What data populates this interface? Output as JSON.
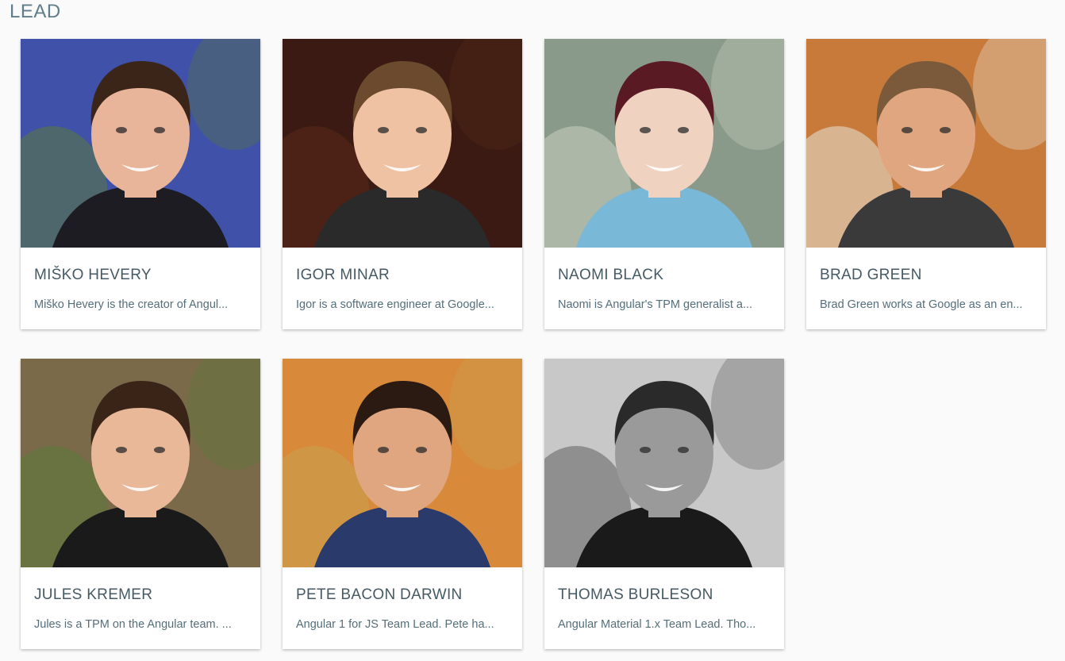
{
  "section": {
    "title": "LEAD"
  },
  "members": [
    {
      "name": "MIŠKO HEVERY",
      "desc": "Miško Hevery is the creator of Angul...",
      "photo": {
        "bg": "#3f51a8",
        "skin": "#e8b49a",
        "hair": "#3b2418",
        "shirt": "#1c1c22",
        "accent": "#5a7a3a"
      }
    },
    {
      "name": "IGOR MINAR",
      "desc": "Igor is a software engineer at Google...",
      "photo": {
        "bg": "#3a1a12",
        "skin": "#f0c2a4",
        "hair": "#6b4a2e",
        "shirt": "#2a2a2a",
        "accent": "#5a2a18"
      }
    },
    {
      "name": "NAOMI BLACK",
      "desc": "Naomi is Angular's TPM generalist a...",
      "photo": {
        "bg": "#8a9a8a",
        "skin": "#f0d2c0",
        "hair": "#5a1a24",
        "shirt": "#7ab8d8",
        "accent": "#c8d0c0"
      }
    },
    {
      "name": "BRAD GREEN",
      "desc": "Brad Green works at Google as an en...",
      "photo": {
        "bg": "#c87a3a",
        "skin": "#e0a680",
        "hair": "#7a5a3a",
        "shirt": "#3a3a3a",
        "accent": "#e8e4d8"
      }
    },
    {
      "name": "JULES KREMER",
      "desc": "Jules is a TPM on the Angular team. ...",
      "photo": {
        "bg": "#7a6a4a",
        "skin": "#e8b898",
        "hair": "#3a2418",
        "shirt": "#1a1a1a",
        "accent": "#5a7a3a"
      }
    },
    {
      "name": "PETE BACON DARWIN",
      "desc": "Angular 1 for JS Team Lead. Pete ha...",
      "photo": {
        "bg": "#d88a3a",
        "skin": "#e0a680",
        "hair": "#2a1a12",
        "shirt": "#2a3a6a",
        "accent": "#c8a050"
      }
    },
    {
      "name": "THOMAS BURLESON",
      "desc": "Angular Material 1.x Team Lead. Tho...",
      "photo": {
        "bg": "#c8c8c8",
        "skin": "#9a9a9a",
        "hair": "#2a2a2a",
        "shirt": "#1a1a1a",
        "accent": "#606060"
      }
    }
  ]
}
